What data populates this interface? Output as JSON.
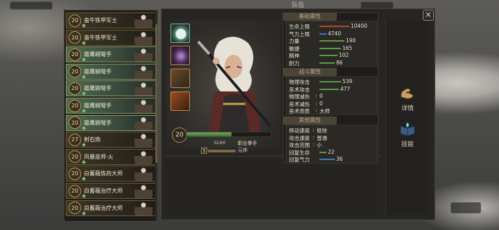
{
  "window": {
    "title": "队伍",
    "close_label": "✕"
  },
  "roster": [
    {
      "level": "20",
      "name": "蛮牛铁甲军士",
      "selected": false
    },
    {
      "level": "20",
      "name": "蛮牛铁甲军士",
      "selected": false
    },
    {
      "level": "20",
      "name": "雄鹰翱弩手",
      "selected": true
    },
    {
      "level": "20",
      "name": "雄鹰翱弩手",
      "selected": true
    },
    {
      "level": "20",
      "name": "雄鹰翱弩手",
      "selected": true
    },
    {
      "level": "20",
      "name": "雄鹰翱弩手",
      "selected": true
    },
    {
      "level": "20",
      "name": "雄鹰翱弩手",
      "selected": true
    },
    {
      "level": "27",
      "name": "射石炮",
      "selected": false
    },
    {
      "level": "20",
      "name": "风暴巫师·火",
      "selected": false
    },
    {
      "level": "20",
      "name": "白蓄薇炼药大师",
      "selected": false
    },
    {
      "level": "20",
      "name": "白蓄薇治疗大师",
      "selected": false
    },
    {
      "level": "20",
      "name": "白蓄薇治疗大师",
      "selected": false
    }
  ],
  "skills": [
    {
      "icon": "orb-skill-icon",
      "caption": ""
    },
    {
      "icon": "curse-skill-icon",
      "caption": ""
    },
    {
      "icon": "weapon-skill-icon",
      "caption": ""
    },
    {
      "icon": "fire-skill-icon",
      "caption": ""
    }
  ],
  "hero": {
    "level": "20",
    "exp_text": "32/60",
    "exp_fraction": 0.53,
    "job": "职业拳手",
    "rank_num": "5",
    "rank_label": "元帅"
  },
  "basic_section": {
    "title": "基础属性",
    "rows": [
      {
        "label": "生命上限",
        "value": "10400",
        "color": "#c2412e",
        "fill": 0.9
      },
      {
        "label": "气力上限",
        "value": "4740",
        "color": "#3f7ac2",
        "fill": 0.2
      },
      {
        "label": "力量",
        "value": "190",
        "color": "#5f9a3f",
        "fill": 0.75
      },
      {
        "label": "敏捷",
        "value": "165",
        "color": "#5f9a3f",
        "fill": 0.65
      },
      {
        "label": "精神",
        "value": "102",
        "color": "#5f9a3f",
        "fill": 0.55
      },
      {
        "label": "耐力",
        "value": "86",
        "color": "#5f9a3f",
        "fill": 0.45
      }
    ]
  },
  "combat_section": {
    "title": "战斗属性",
    "rows": [
      {
        "label": "物理攻击",
        "value": "539",
        "color": "#5f9a3f",
        "fill": 0.65
      },
      {
        "label": "巫术攻击",
        "value": "477",
        "color": "#5f9a3f",
        "fill": 0.58
      },
      {
        "label": "物理减伤",
        "value": "0",
        "color": "",
        "fill": 0
      },
      {
        "label": "巫术减伤",
        "value": "0",
        "color": "",
        "fill": 0
      },
      {
        "label": "巫术资质",
        "value": "大师",
        "color": "",
        "fill": 0
      }
    ]
  },
  "other_section": {
    "title": "其他属性",
    "rows": [
      {
        "label": "移动速度",
        "value": "极快",
        "color": "",
        "fill": 0
      },
      {
        "label": "攻击速度",
        "value": "普通",
        "color": "",
        "fill": 0
      },
      {
        "label": "攻击范围",
        "value": "小",
        "color": "",
        "fill": 0
      },
      {
        "label": "回复生命",
        "value": "22",
        "color": "#5f9a3f",
        "fill": 0.2
      },
      {
        "label": "回复气力",
        "value": "36",
        "color": "#3f7ac2",
        "fill": 0.45
      }
    ]
  },
  "side_buttons": [
    {
      "label": "详情",
      "icon": "flexed-arm-icon"
    },
    {
      "label": "技能",
      "icon": "spell-book-icon"
    }
  ]
}
